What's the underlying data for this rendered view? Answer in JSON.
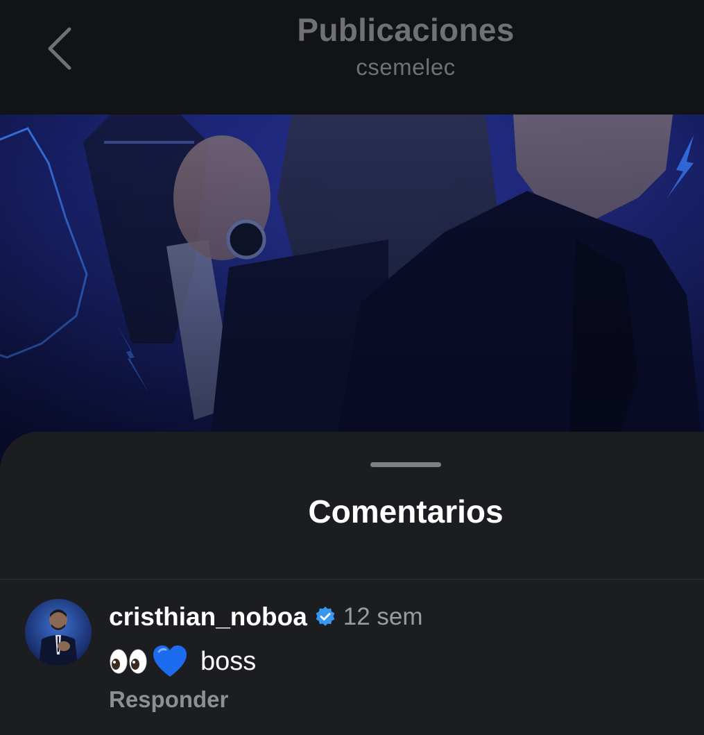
{
  "nav": {
    "title": "Publicaciones",
    "subtitle": "csemelec",
    "back_icon": "chevron-left-icon"
  },
  "post": {
    "image_description_icon": "post-photo"
  },
  "comments_sheet": {
    "title": "Comentarios",
    "comments": [
      {
        "username": "cristhian_noboa",
        "verified": true,
        "time": "12 sem",
        "emojis": [
          "eyes-icon",
          "blue-heart-icon"
        ],
        "text": "boss",
        "reply_label": "Responder"
      }
    ]
  },
  "colors": {
    "background": "#111214",
    "sheet": "#1b1d21",
    "nav_text": "#6f7175",
    "verified_blue": "#3897f0",
    "heart_blue": "#1d6cf0",
    "muted_text": "#9a9ca1"
  }
}
